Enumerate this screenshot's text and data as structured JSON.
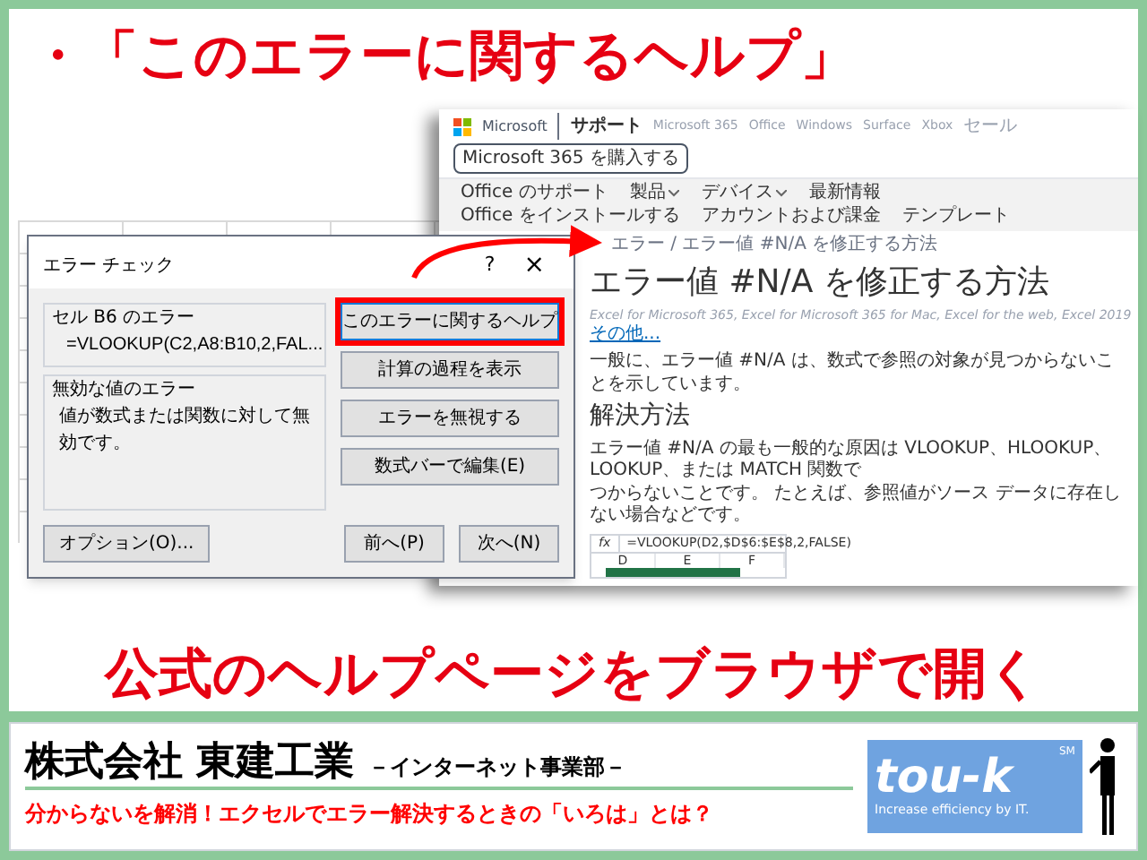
{
  "heading": {
    "bullet": "・",
    "text": "「このエラーに関するヘルプ」"
  },
  "browser": {
    "brand": "Microsoft",
    "section": "サポート",
    "links": [
      "Microsoft 365",
      "Office",
      "Windows",
      "Surface",
      "Xbox",
      "セール"
    ],
    "buy_button": "Microsoft 365 を購入する",
    "sub_nav": [
      {
        "label": "Office のサポート",
        "dropdown": false
      },
      {
        "label": "製品",
        "dropdown": true
      },
      {
        "label": "デバイス",
        "dropdown": true
      },
      {
        "label": "最新情報",
        "dropdown": false
      },
      {
        "label": "Office をインストールする",
        "dropdown": false
      },
      {
        "label": "アカウントおよび課金",
        "dropdown": false
      },
      {
        "label": "テンプレート",
        "dropdown": false
      }
    ],
    "breadcrumb": "エラー / エラー値 #N/A を修正する方法",
    "title": "エラー値 #N/A を修正する方法",
    "applies_to": "Excel for Microsoft 365, Excel for Microsoft 365 for Mac, Excel for the web, Excel 2019",
    "more_link": "その他...",
    "intro": "一般に、エラー値 #N/A は、数式で参照の対象が見つからないことを示しています。",
    "section_title": "解決方法",
    "section_lines": [
      "エラー値 #N/A の最も一般的な原因は VLOOKUP、HLOOKUP、LOOKUP、または MATCH 関数で",
      "つからないことです。 たとえば、参照値がソース データに存在しない場合などです。"
    ],
    "sheet": {
      "name_box": "fx",
      "formula": "=VLOOKUP(D2,$D$6:$E$8,2,FALSE)",
      "columns": [
        "D",
        "E",
        "F"
      ]
    }
  },
  "dialog": {
    "title": "エラー チェック",
    "help": "?",
    "close": "×",
    "cell_label": "セル B6 のエラー",
    "formula": "=VLOOKUP(C2,A8:B10,2,FAL...",
    "error_label": "無効な値のエラー",
    "message": "値が数式または関数に対して無効です。",
    "actions": [
      {
        "label": "このエラーに関するヘルプ",
        "highlighted": true
      },
      {
        "label": "計算の過程を表示",
        "highlighted": false
      },
      {
        "label": "エラーを無視する",
        "highlighted": false
      },
      {
        "label": "数式バーで編集(E)",
        "highlighted": false
      }
    ],
    "options": "オプション(O)...",
    "nav": [
      "前へ(P)",
      "次へ(N)"
    ]
  },
  "caption": "公式のヘルプページをブラウザで開く",
  "footer": {
    "company": "株式会社 東建工業",
    "division": "－インターネット事業部－",
    "tagline": "分からないを解消！エクセルでエラー解決するときの「いろは」とは？",
    "logo_text": "tou-k",
    "logo_mark": "SM",
    "slogan": "Increase efficiency by IT."
  }
}
